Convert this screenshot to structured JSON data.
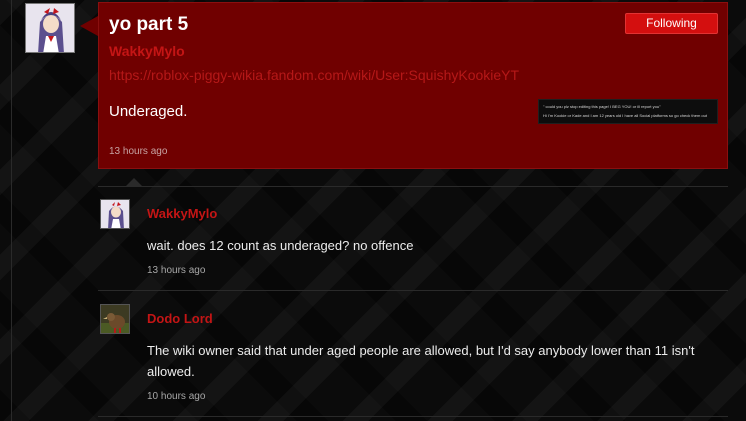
{
  "post": {
    "title": "yo part 5",
    "follow_label": "Following",
    "author": "WakkyMylo",
    "link": "https://roblox-piggy-wikia.fandom.com/wiki/User:SquishyKookieYT",
    "body": "Underaged.",
    "time": "13 hours ago",
    "thumbnail_lines": [
      "\" could you plz stop editing this page! I BEG YOU! or ill report you\"",
      "Hi I'm Kookie or Kade and I am 12 years old I have all Social platforms so go check them out"
    ]
  },
  "comments": [
    {
      "author": "WakkyMylo",
      "body": "wait. does 12 count as underaged? no offence",
      "time": "13 hours ago"
    },
    {
      "author": "Dodo Lord",
      "body": "The wiki owner said that under aged people are allowed, but I'd say anybody lower than 11 isn't allowed.",
      "time": "10 hours ago"
    }
  ],
  "colors": {
    "card_bg": "#700000",
    "accent_red": "#c41515",
    "button_red": "#d40f0f"
  }
}
